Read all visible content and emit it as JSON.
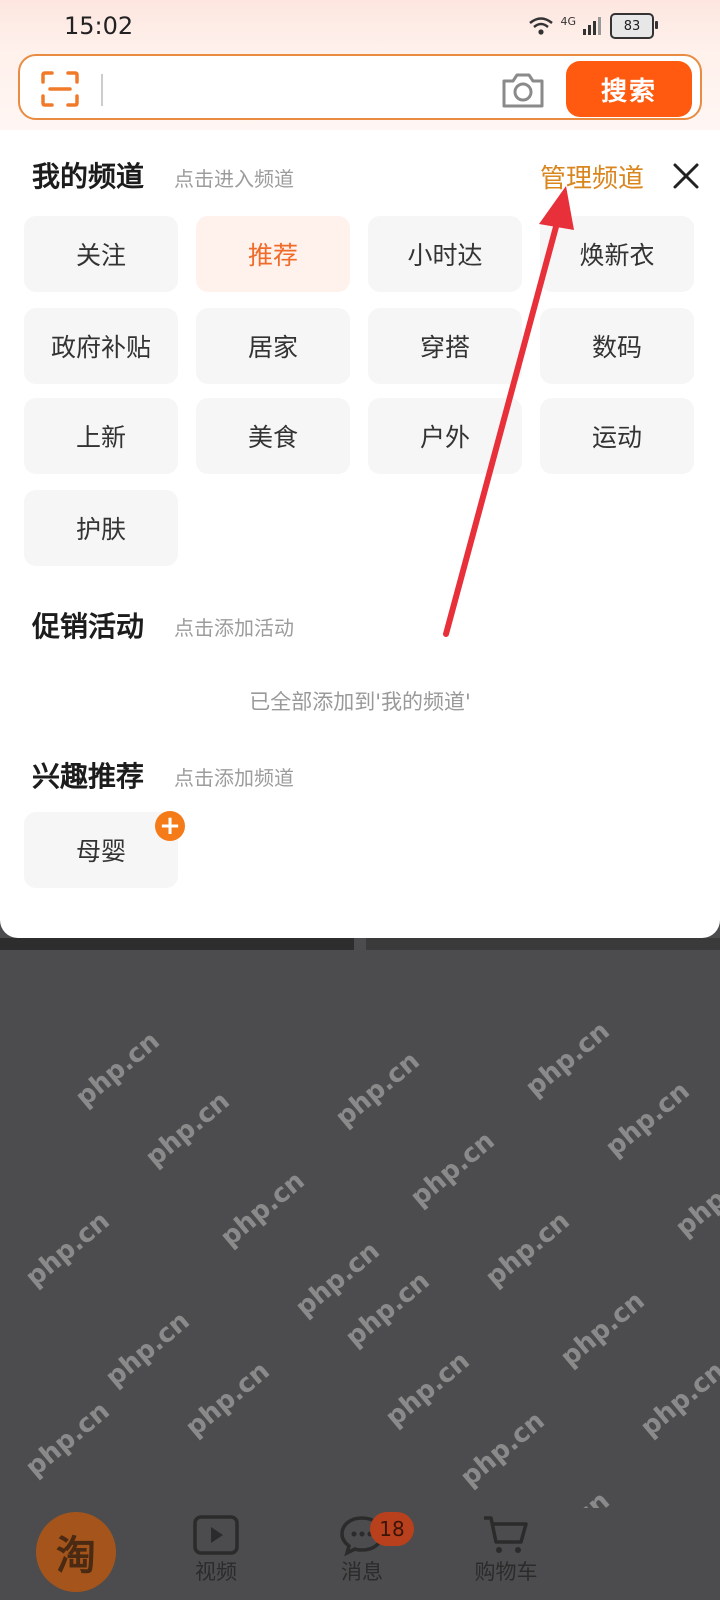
{
  "status_bar": {
    "time": "15:02",
    "network": "4G",
    "battery": "83"
  },
  "search": {
    "placeholder": "",
    "button_label": "搜索"
  },
  "my_channels": {
    "title": "我的频道",
    "subtitle": "点击进入频道",
    "manage_label": "管理频道",
    "items": [
      {
        "label": "关注",
        "active": false
      },
      {
        "label": "推荐",
        "active": true
      },
      {
        "label": "小时达",
        "active": false
      },
      {
        "label": "焕新衣",
        "active": false
      },
      {
        "label": "政府补贴",
        "active": false
      },
      {
        "label": "居家",
        "active": false
      },
      {
        "label": "穿搭",
        "active": false
      },
      {
        "label": "数码",
        "active": false
      },
      {
        "label": "上新",
        "active": false
      },
      {
        "label": "美食",
        "active": false
      },
      {
        "label": "户外",
        "active": false
      },
      {
        "label": "运动",
        "active": false
      },
      {
        "label": "护肤",
        "active": false
      }
    ]
  },
  "promotions": {
    "title": "促销活动",
    "subtitle": "点击添加活动",
    "empty_message": "已全部添加到'我的频道'"
  },
  "interests": {
    "title": "兴趣推荐",
    "subtitle": "点击添加频道",
    "items": [
      {
        "label": "母婴"
      }
    ]
  },
  "watermark": "php.cn",
  "bottom_nav": {
    "logo": "淘",
    "items": [
      {
        "label": "视频"
      },
      {
        "label": "消息"
      },
      {
        "label": "购物车"
      }
    ],
    "message_badge": "18"
  },
  "colors": {
    "accent": "#ff5a10",
    "manage": "#d9861f",
    "annotation_arrow": "#e8303a"
  }
}
